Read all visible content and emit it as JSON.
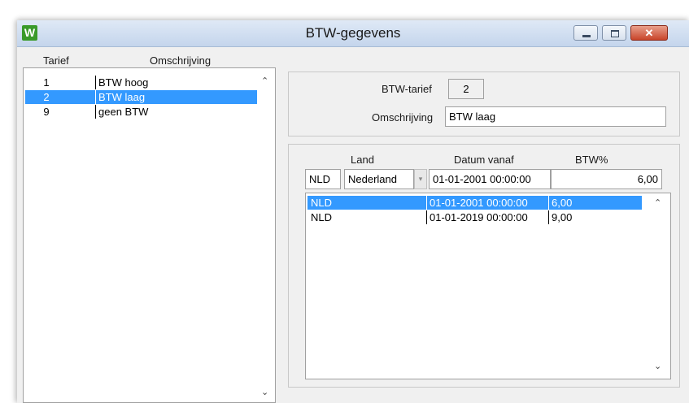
{
  "window": {
    "title": "BTW-gegevens",
    "icon_letter": "W",
    "close_glyph": "✕"
  },
  "list": {
    "headers": {
      "tarief": "Tarief",
      "omschrijving": "Omschrijving"
    },
    "rows": [
      {
        "num": "1",
        "text": "BTW hoog",
        "selected": false
      },
      {
        "num": "2",
        "text": "BTW laag",
        "selected": true
      },
      {
        "num": "9",
        "text": "geen BTW",
        "selected": false
      }
    ],
    "scroll_up": "⌃",
    "scroll_down": "⌄"
  },
  "detail": {
    "tarief_label": "BTW-tarief",
    "tarief_value": "2",
    "omschrijving_label": "Omschrijving",
    "omschrijving_value": "BTW laag"
  },
  "rates": {
    "headers": {
      "land": "Land",
      "datum": "Datum vanaf",
      "pct": "BTW%"
    },
    "edit": {
      "code": "NLD",
      "country": "Nederland",
      "date": "01-01-2001 00:00:00",
      "pct": "6,00",
      "dropdown_glyph": "▾"
    },
    "rows": [
      {
        "code": "NLD",
        "date": "01-01-2001 00:00:00",
        "pct": "6,00",
        "selected": true
      },
      {
        "code": "NLD",
        "date": "01-01-2019 00:00:00",
        "pct": "9,00",
        "selected": false
      }
    ],
    "scroll_up": "⌃",
    "scroll_down": "⌄"
  },
  "colors": {
    "selection": "#3399ff",
    "title_bar": "#c4d5ec",
    "close_button": "#c8442a"
  }
}
